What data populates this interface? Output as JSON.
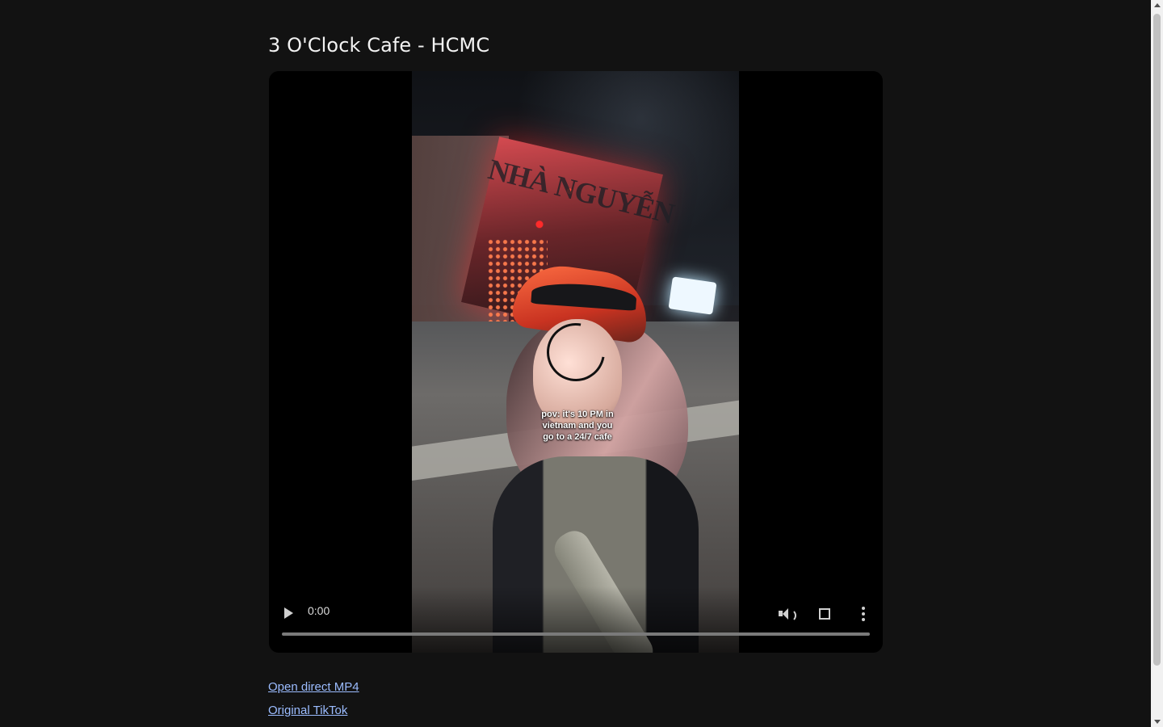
{
  "page": {
    "title": "3 O'Clock Cafe - HCMC"
  },
  "video": {
    "caption_line_1": "pov: it's 10 PM in",
    "caption_line_2": "vietnam and you",
    "caption_line_3": "go to a 24/7 cafe",
    "storefront_text": "NHÀ NGUYỄN",
    "current_time": "0:00",
    "progress_percent": 0,
    "icons": {
      "play": "play-icon",
      "volume": "volume-icon",
      "fullscreen": "fullscreen-icon",
      "more": "more-options-icon",
      "loading": "loading-spinner-icon"
    }
  },
  "links": {
    "direct_mp4": "Open direct MP4",
    "original_tiktok": "Original TikTok"
  },
  "colors": {
    "background": "#121212",
    "link": "#9bbcff",
    "text": "#f2f2f2"
  }
}
